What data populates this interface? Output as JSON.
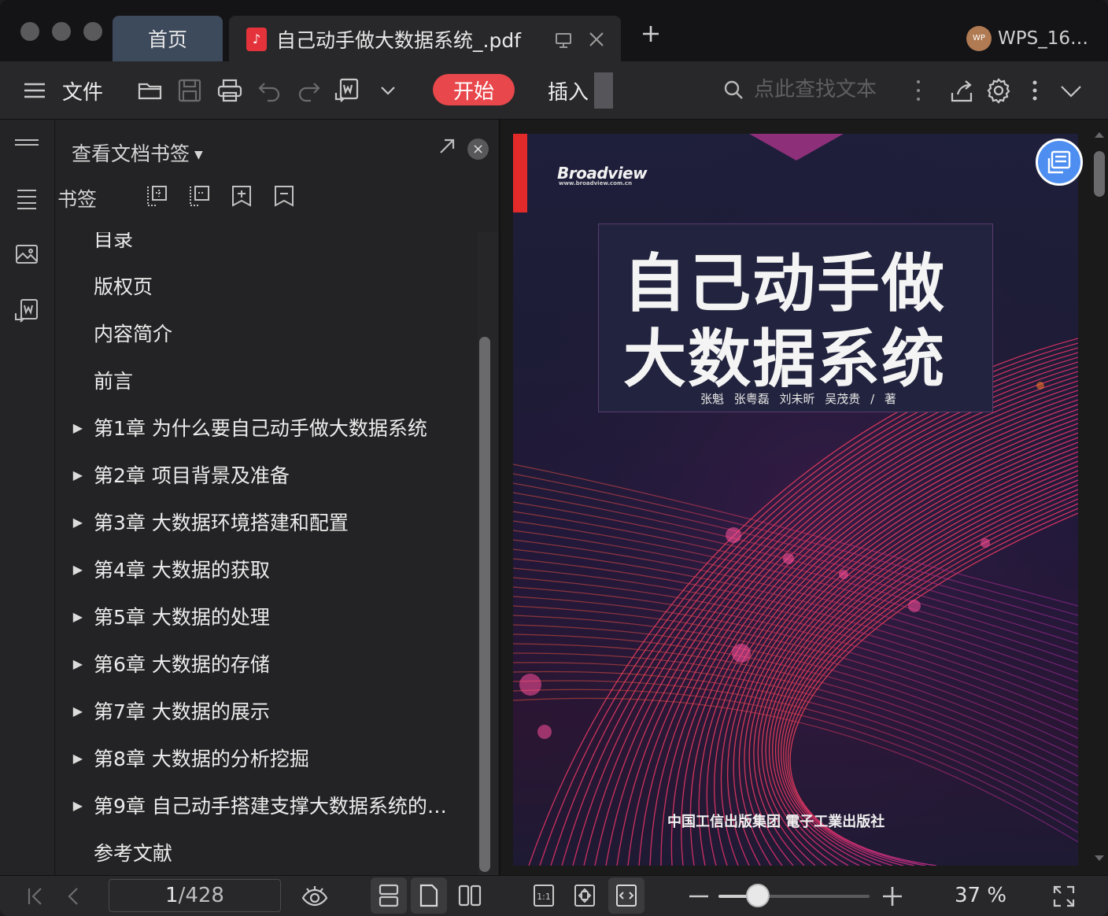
{
  "titlebar": {
    "home_tab": "首页",
    "doc_tab": "自己动手做大数据系统_.pdf",
    "account_badge": "WP",
    "account_name": "WPS_16…"
  },
  "toolbar": {
    "menu_label": "文件",
    "start_tab": "开始",
    "insert_tab": "插入",
    "search_placeholder": "点此查找文本",
    "accent_color": "#e8474b"
  },
  "panel": {
    "title": "查看文档书签",
    "bookmark_label": "书签",
    "items": [
      {
        "label": "目录",
        "expandable": false
      },
      {
        "label": "版权页",
        "expandable": false
      },
      {
        "label": "内容简介",
        "expandable": false
      },
      {
        "label": "前言",
        "expandable": false
      },
      {
        "label": "第1章 为什么要自己动手做大数据系统",
        "expandable": true
      },
      {
        "label": "第2章 项目背景及准备",
        "expandable": true
      },
      {
        "label": "第3章 大数据环境搭建和配置",
        "expandable": true
      },
      {
        "label": "第4章 大数据的获取",
        "expandable": true
      },
      {
        "label": "第5章 大数据的处理",
        "expandable": true
      },
      {
        "label": "第6章 大数据的存储",
        "expandable": true
      },
      {
        "label": "第7章 大数据的展示",
        "expandable": true
      },
      {
        "label": "第8章 大数据的分析挖掘",
        "expandable": true
      },
      {
        "label": "第9章 自己动手搭建支撑大数据系统的…",
        "expandable": true
      },
      {
        "label": "参考文献",
        "expandable": false
      }
    ]
  },
  "cover": {
    "publisher": "Broadview",
    "publisher_sub": "www.broadview.com.cn",
    "title_line1": "自己动手做",
    "title_line2": "大数据系统",
    "authors": "张魁 张粤磊 刘未昕 吴茂贵 / 著",
    "bottom_text": "中国工信出版集团   電子工業出版社"
  },
  "status": {
    "current_page": "1",
    "total_pages": "/428",
    "zoom": "37 %",
    "zoom_fraction": 0.26
  }
}
